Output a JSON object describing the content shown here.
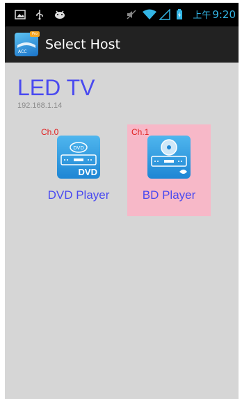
{
  "status_bar": {
    "ampm": "上午",
    "time": "9:20",
    "icons": [
      "image-icon",
      "usb-icon",
      "android-debug-icon",
      "mute-icon",
      "wifi-icon",
      "signal-icon",
      "battery-charging-icon"
    ]
  },
  "action_bar": {
    "title": "Select Host",
    "app_icon": "acc-pro-app-icon",
    "app_icon_badge": "Pro",
    "app_icon_text": "ACC"
  },
  "host": {
    "name": "LED TV",
    "ip": "192.168.1.14"
  },
  "devices": [
    {
      "channel": "Ch.0",
      "label": "DVD Player",
      "icon": "dvd-player-icon",
      "icon_top_text": "DVD",
      "icon_bottom_text": "DVD",
      "selected": false
    },
    {
      "channel": "Ch.1",
      "label": "BD Player",
      "icon": "bluray-player-icon",
      "icon_top_text": "",
      "icon_bottom_text": "",
      "selected": true
    }
  ],
  "colors": {
    "accent_blue": "#4a4af0",
    "channel_red": "#e02020",
    "selected_bg": "#f7b8c8",
    "statusbar_accent": "#33b5e5"
  }
}
